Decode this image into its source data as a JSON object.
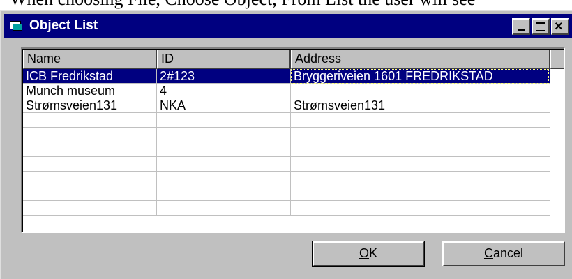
{
  "background_text": "When choosing File, Choose Object, From List the user will see",
  "window": {
    "title": "Object List",
    "buttons": {
      "minimize": "minimize",
      "maximize": "maximize",
      "close": "close"
    }
  },
  "list": {
    "columns": [
      "Name",
      "ID",
      "Address"
    ],
    "rows": [
      {
        "name": "ICB Fredrikstad",
        "id": "2#123",
        "address": "Bryggeriveien  1601 FREDRIKSTAD",
        "selected": true
      },
      {
        "name": "Munch museum",
        "id": "4",
        "address": ""
      },
      {
        "name": "Strømsveien131",
        "id": "NKA",
        "address": "Strømsveien131"
      },
      {
        "name": "",
        "id": "",
        "address": ""
      },
      {
        "name": "",
        "id": "",
        "address": ""
      },
      {
        "name": "",
        "id": "",
        "address": ""
      },
      {
        "name": "",
        "id": "",
        "address": ""
      },
      {
        "name": "",
        "id": "",
        "address": ""
      },
      {
        "name": "",
        "id": "",
        "address": ""
      },
      {
        "name": "",
        "id": "",
        "address": ""
      }
    ]
  },
  "ok_button": {
    "mnemonic": "O",
    "rest": "K"
  },
  "cancel_button": {
    "mnemonic": "C",
    "rest": "ancel"
  },
  "colors": {
    "titlebar": "#000080",
    "selection": "#000080",
    "face": "#c0c0c0"
  }
}
